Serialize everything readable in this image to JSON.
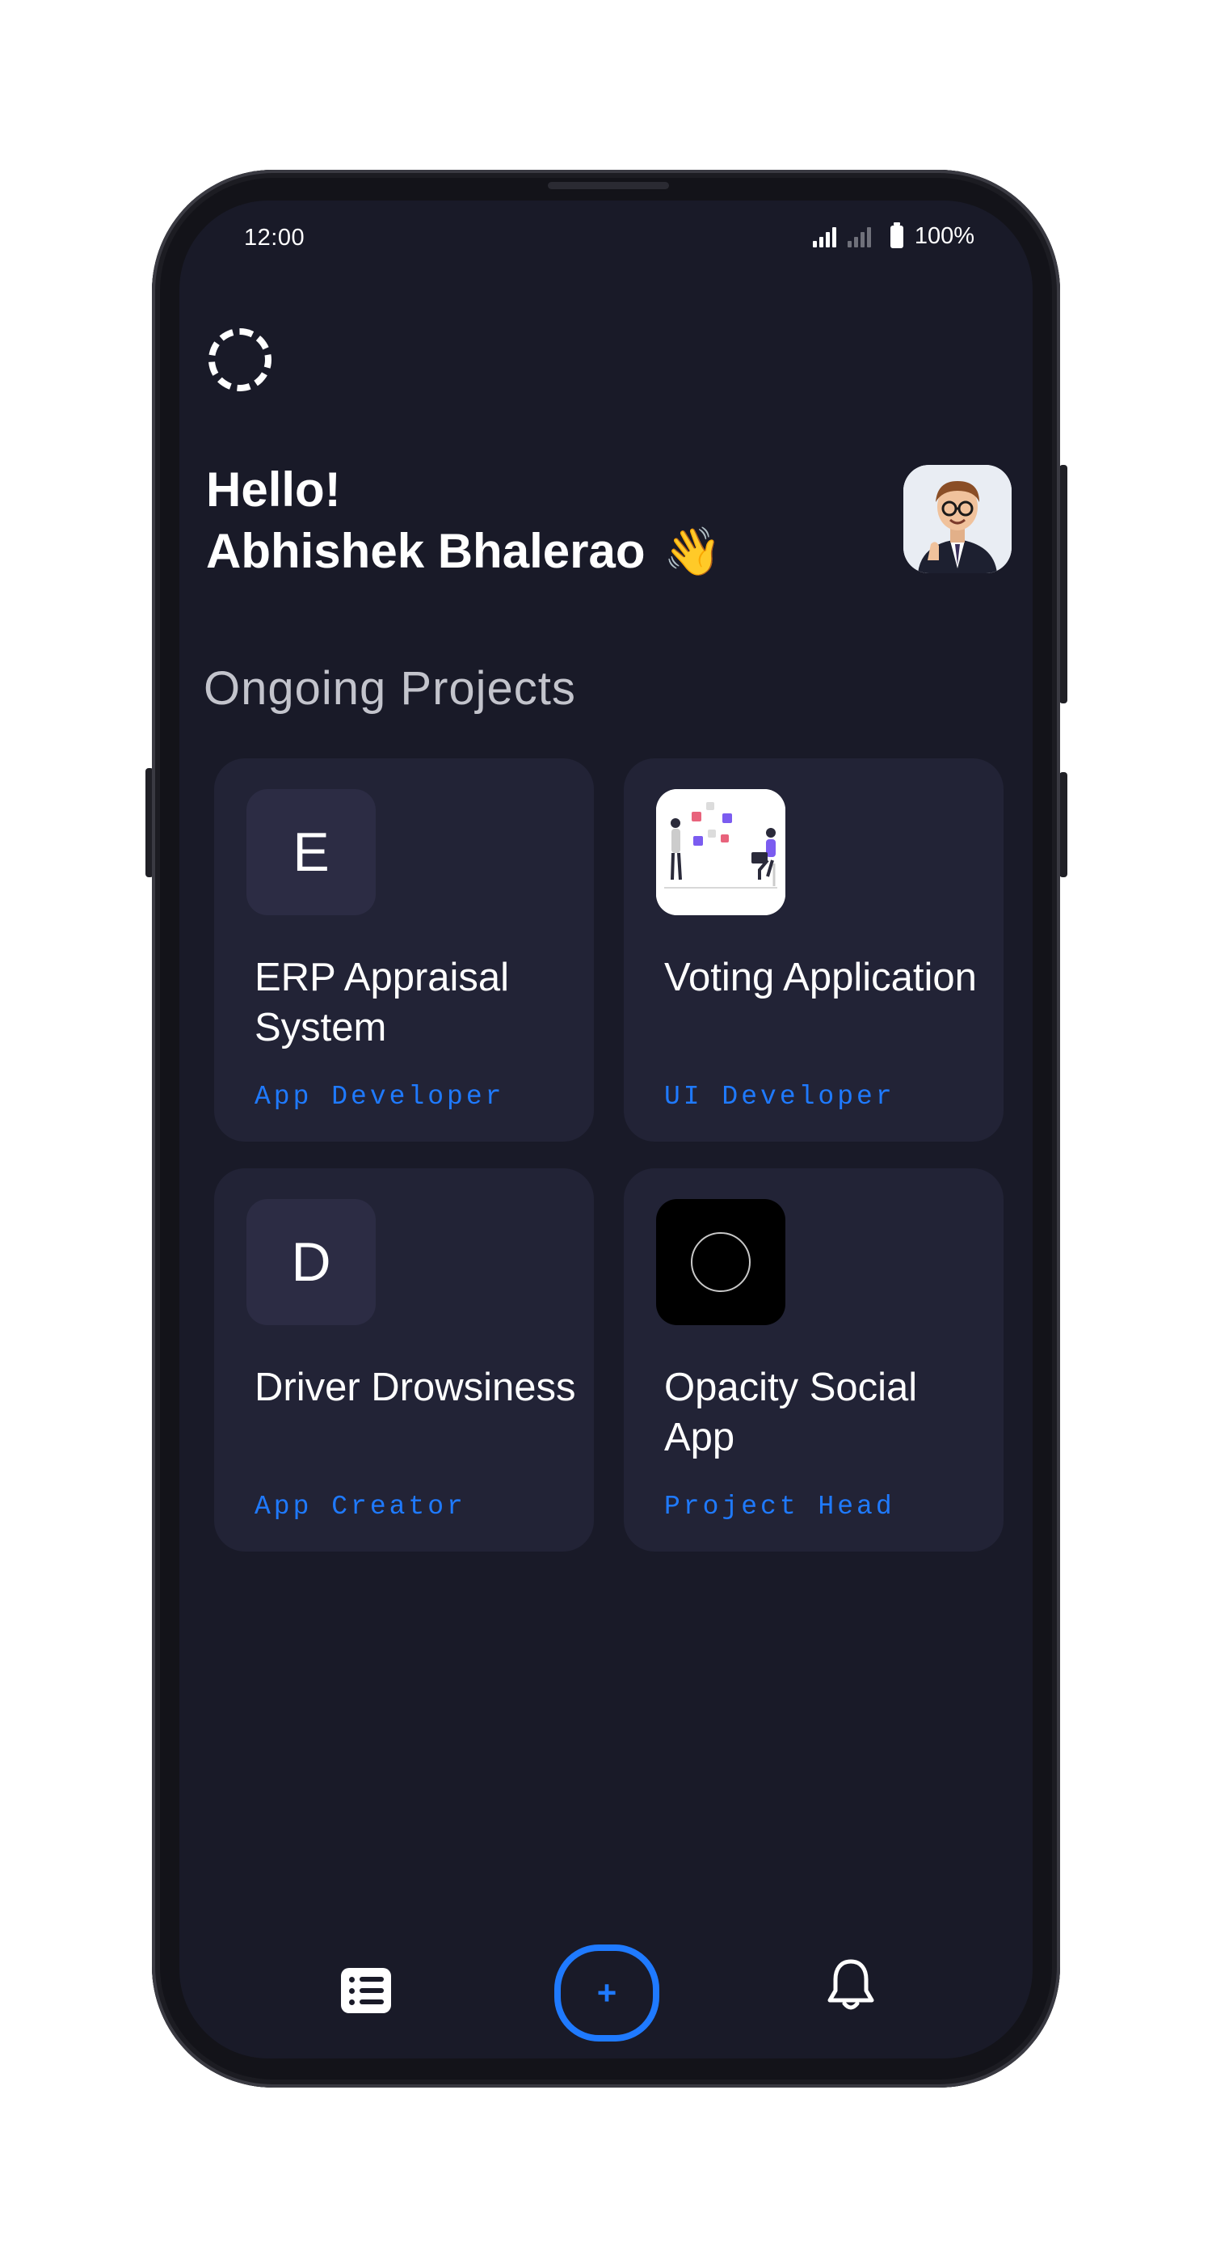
{
  "status_bar": {
    "time": "12:00",
    "battery": "100%"
  },
  "greeting": {
    "line1": "Hello!",
    "name": "Abhishek Bhalerao",
    "emoji": "👋"
  },
  "section_title": "Ongoing Projects",
  "projects": [
    {
      "thumb_letter": "E",
      "title": "ERP Appraisal System",
      "role": "App Developer"
    },
    {
      "thumb_letter": "",
      "title": "Voting Application",
      "role": "UI Developer"
    },
    {
      "thumb_letter": "D",
      "title": "Driver Drowsiness",
      "role": "App Creator"
    },
    {
      "thumb_letter": "",
      "title": "Opacity Social App",
      "role": "Project Head"
    }
  ],
  "nav": {
    "add_symbol": "+"
  },
  "colors": {
    "screen_bg": "#191a28",
    "card_bg": "#222336",
    "accent": "#1f7aff"
  }
}
